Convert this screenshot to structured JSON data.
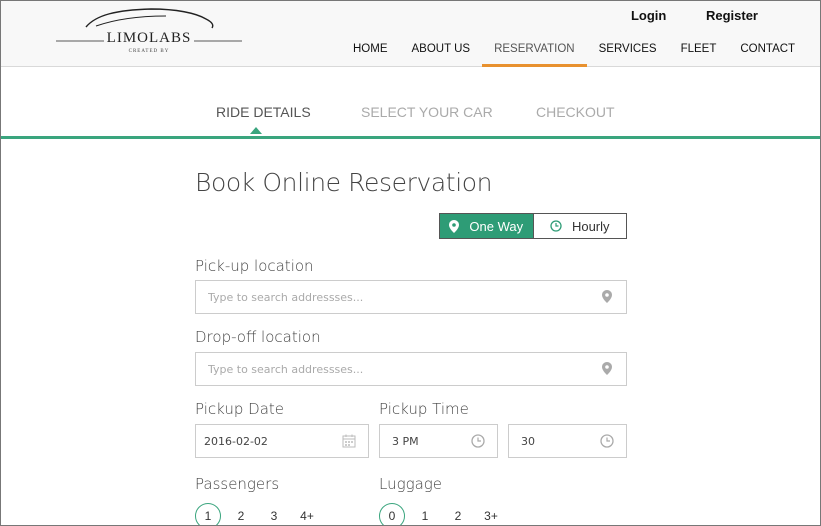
{
  "brand": {
    "name": "LIMOLABS",
    "sub": "CREATED BY"
  },
  "auth": {
    "login": "Login",
    "register": "Register"
  },
  "nav": [
    {
      "label": "HOME",
      "active": false
    },
    {
      "label": "ABOUT US",
      "active": false
    },
    {
      "label": "RESERVATION",
      "active": true
    },
    {
      "label": "SERVICES",
      "active": false
    },
    {
      "label": "FLEET",
      "active": false
    },
    {
      "label": "CONTACT",
      "active": false
    }
  ],
  "steps": [
    {
      "label": "RIDE DETAILS",
      "active": true
    },
    {
      "label": "SELECT YOUR CAR",
      "active": false
    },
    {
      "label": "CHECKOUT",
      "active": false
    }
  ],
  "form": {
    "title": "Book Online Reservation",
    "trip_type": {
      "one_way": "One Way",
      "hourly": "Hourly",
      "selected": "One Way"
    },
    "pickup_label": "Pick-up location",
    "pickup_placeholder": "Type to search addressses...",
    "dropoff_label": "Drop-off location",
    "dropoff_placeholder": "Type to search addressses...",
    "date_label": "Pickup Date",
    "date_value": "2016-02-02",
    "time_label": "Pickup Time",
    "time_hour": "3 PM",
    "time_minute": "30",
    "passengers_label": "Passengers",
    "passengers": [
      "1",
      "2",
      "3",
      "4+"
    ],
    "passengers_selected": "1",
    "luggage_label": "Luggage",
    "luggage": [
      "0",
      "1",
      "2",
      "3+"
    ],
    "luggage_selected": "0"
  },
  "colors": {
    "accent_green": "#2e9c76",
    "nav_underline": "#e8912f"
  }
}
